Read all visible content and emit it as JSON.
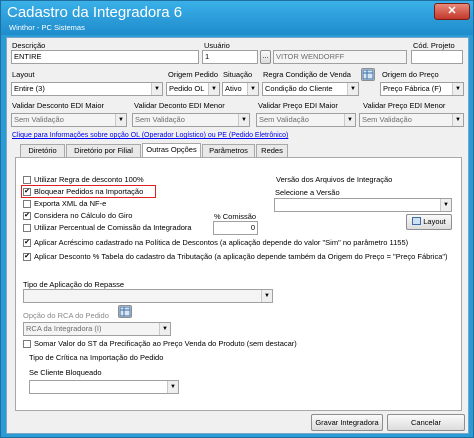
{
  "window": {
    "title": "Cadastro da Integradora 6",
    "subtitle": "Winthor - PC Sistemas",
    "close_glyph": "✕"
  },
  "header": {
    "descricao_label": "Descrição",
    "descricao_value": "ENTIRE",
    "usuario_label": "Usuário",
    "usuario_code": "1",
    "usuario_lookup": "...",
    "usuario_name": "VITOR WENDORFF",
    "cod_projeto_label": "Cód. Projeto",
    "cod_projeto_value": ""
  },
  "row2": {
    "layout_label": "Layout",
    "layout_value": "Entire (3)",
    "origem_pedido_label": "Origem Pedido",
    "origem_pedido_value": "Pedido OL",
    "situacao_label": "Situação",
    "situacao_value": "Ativo",
    "regra_label": "Regra Condição de Venda",
    "regra_value": "Condição do Cliente",
    "origem_preco_label": "Origem do Preço",
    "origem_preco_value": "Preço Fábrica (F)"
  },
  "row3": {
    "val_desc_maior_label": "Validar Desconto EDI Maior",
    "val_desc_maior_value": "Sem Validação",
    "val_desc_menor_label": "Validar Deconto EDI Menor",
    "val_desc_menor_value": "Sem Validação",
    "val_preco_maior_label": "Validar Preço EDI Maior",
    "val_preco_maior_value": "Sem Validação",
    "val_preco_menor_label": "Validar Preço EDI Menor",
    "val_preco_menor_value": "Sem Validação"
  },
  "info_link": "Clique para Informações sobre opção OL (Operador Logístico) ou PE (Pedido Eletrônico)",
  "tabs": [
    {
      "label": "Diretório"
    },
    {
      "label": "Diretório por Filial"
    },
    {
      "label": "Outras Opções"
    },
    {
      "label": "Parâmetros"
    },
    {
      "label": "Redes"
    }
  ],
  "options": {
    "regra_desconto": "Utilizar Regra de desconto 100%",
    "bloquear_pedidos": "Bloquear Pedidos na Importação",
    "exporta_xml": "Exporta XML da NF-e",
    "considera_giro": "Considera no Cálculo do Giro",
    "perc_comissao": "Utilizar Percentual de Comissão da Integradora",
    "perc_comissao_label": "% Comissão",
    "perc_comissao_value": "0",
    "aplicar_acrescimo": "Aplicar Acréscimo cadastrado na Política de Descontos (a aplicação depende do valor \"Sim\" no parâmetro 1155)",
    "aplicar_desconto": "Aplicar Desconto % Tabela do cadastro da Tributação (a aplicação depende também da Origem do Preço = \"Preço Fábrica\")",
    "check_mark": "✔"
  },
  "versao": {
    "title": "Versão dos Arquivos de Integração",
    "selecione_label": "Selecione a Versão",
    "selecione_value": "",
    "layout_button": "Layout"
  },
  "repasse": {
    "label": "Tipo de Aplicação do Repasse",
    "value": ""
  },
  "rca": {
    "label": "Opção do RCA do Pedido",
    "value": "RCA da Integradora (I)",
    "somar_st": "Somar Valor do ST da Precificação ao Preço Venda do Produto (sem destacar)"
  },
  "critica": {
    "title": "Tipo de Crítica na Importação do Pedido",
    "se_cliente_label": "Se Cliente Bloqueado",
    "se_cliente_value": ""
  },
  "footer": {
    "gravar": "Gravar Integradora",
    "cancelar": "Cancelar"
  }
}
